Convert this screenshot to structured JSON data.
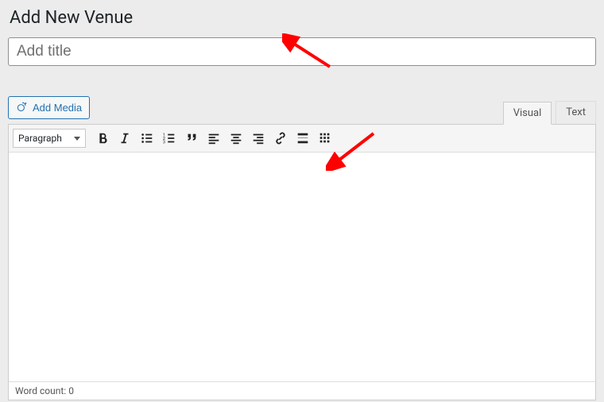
{
  "page": {
    "title": "Add New Venue"
  },
  "titleField": {
    "placeholder": "Add title",
    "value": ""
  },
  "mediaButton": {
    "label": "Add Media"
  },
  "tabs": {
    "visual": "Visual",
    "text": "Text",
    "active": "visual"
  },
  "formatSelect": {
    "label": "Paragraph"
  },
  "toolbarIcons": [
    "bold-icon",
    "italic-icon",
    "bulleted-list-icon",
    "numbered-list-icon",
    "blockquote-icon",
    "align-left-icon",
    "align-center-icon",
    "align-right-icon",
    "link-icon",
    "read-more-icon",
    "toolbar-toggle-icon"
  ],
  "statusbar": {
    "wordCountLabel": "Word count:",
    "wordCountValue": "0"
  },
  "annotations": {
    "arrow_color": "#ff0000"
  }
}
